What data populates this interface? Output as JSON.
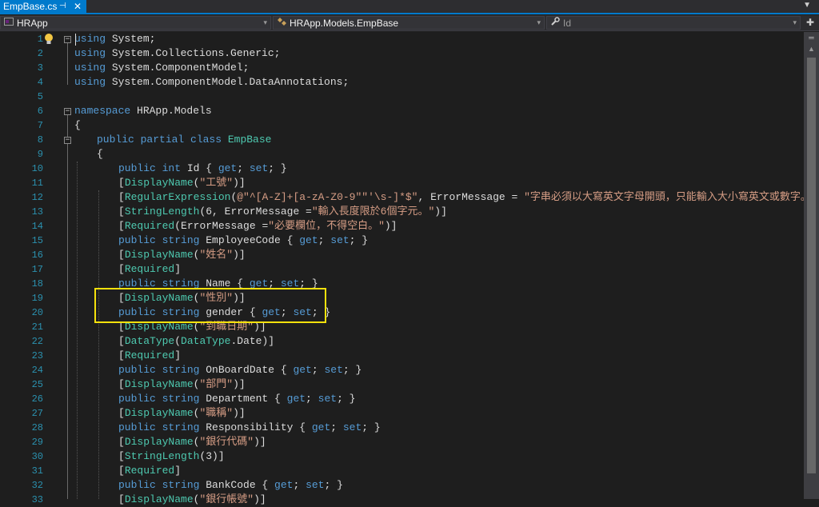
{
  "tab": {
    "title": "EmpBase.cs",
    "pin": "⊣",
    "close": "✕",
    "overflow": "▼"
  },
  "nav": {
    "project": "HRApp",
    "type": "HRApp.Models.EmpBase",
    "member": "Id",
    "arrow": "▾",
    "split_glyph": "✚"
  },
  "lines": [
    {
      "n": "1",
      "indent": 0,
      "parts": [
        {
          "c": "kw",
          "t": "using"
        },
        {
          "c": "",
          "t": " System;"
        }
      ]
    },
    {
      "n": "2",
      "indent": 0,
      "parts": [
        {
          "c": "kw",
          "t": "using"
        },
        {
          "c": "",
          "t": " System.Collections.Generic;"
        }
      ]
    },
    {
      "n": "3",
      "indent": 0,
      "parts": [
        {
          "c": "kw",
          "t": "using"
        },
        {
          "c": "",
          "t": " System.ComponentModel;"
        }
      ]
    },
    {
      "n": "4",
      "indent": 0,
      "parts": [
        {
          "c": "kw",
          "t": "using"
        },
        {
          "c": "",
          "t": " System.ComponentModel.DataAnnotations;"
        }
      ]
    },
    {
      "n": "5",
      "indent": 0,
      "parts": []
    },
    {
      "n": "6",
      "indent": 0,
      "parts": [
        {
          "c": "kw",
          "t": "namespace"
        },
        {
          "c": "",
          "t": " HRApp.Models"
        }
      ]
    },
    {
      "n": "7",
      "indent": 0,
      "parts": [
        {
          "c": "",
          "t": "{"
        }
      ]
    },
    {
      "n": "8",
      "indent": 1,
      "parts": [
        {
          "c": "kw",
          "t": "public partial class"
        },
        {
          "c": "",
          "t": " "
        },
        {
          "c": "tp",
          "t": "EmpBase"
        }
      ]
    },
    {
      "n": "9",
      "indent": 1,
      "parts": [
        {
          "c": "",
          "t": "{"
        }
      ]
    },
    {
      "n": "10",
      "indent": 2,
      "parts": [
        {
          "c": "kw",
          "t": "public int"
        },
        {
          "c": "",
          "t": " Id { "
        },
        {
          "c": "kw",
          "t": "get"
        },
        {
          "c": "",
          "t": "; "
        },
        {
          "c": "kw",
          "t": "set"
        },
        {
          "c": "",
          "t": "; }"
        }
      ]
    },
    {
      "n": "11",
      "indent": 2,
      "parts": [
        {
          "c": "",
          "t": "["
        },
        {
          "c": "tp",
          "t": "DisplayName"
        },
        {
          "c": "",
          "t": "("
        },
        {
          "c": "st",
          "t": "\"工號\""
        },
        {
          "c": "",
          "t": ")]"
        }
      ]
    },
    {
      "n": "12",
      "indent": 2,
      "parts": [
        {
          "c": "",
          "t": "["
        },
        {
          "c": "tp",
          "t": "RegularExpression"
        },
        {
          "c": "",
          "t": "("
        },
        {
          "c": "st",
          "t": "@\"^[A-Z]+[a-zA-Z0-9\"\"'\\s-]*$\""
        },
        {
          "c": "",
          "t": ", ErrorMessage = "
        },
        {
          "c": "st",
          "t": "\"字串必須以大寫英文字母開頭，只能輸入大小寫英文或數字。\""
        },
        {
          "c": "",
          "t": ")]"
        }
      ]
    },
    {
      "n": "13",
      "indent": 2,
      "parts": [
        {
          "c": "",
          "t": "["
        },
        {
          "c": "tp",
          "t": "StringLength"
        },
        {
          "c": "",
          "t": "(6, ErrorMessage ="
        },
        {
          "c": "st",
          "t": "\"輸入長度限於6個字元。\""
        },
        {
          "c": "",
          "t": ")]"
        }
      ]
    },
    {
      "n": "14",
      "indent": 2,
      "parts": [
        {
          "c": "",
          "t": "["
        },
        {
          "c": "tp",
          "t": "Required"
        },
        {
          "c": "",
          "t": "(ErrorMessage ="
        },
        {
          "c": "st",
          "t": "\"必要欄位，不得空白。\""
        },
        {
          "c": "",
          "t": ")]"
        }
      ]
    },
    {
      "n": "15",
      "indent": 2,
      "parts": [
        {
          "c": "kw",
          "t": "public string"
        },
        {
          "c": "",
          "t": " EmployeeCode { "
        },
        {
          "c": "kw",
          "t": "get"
        },
        {
          "c": "",
          "t": "; "
        },
        {
          "c": "kw",
          "t": "set"
        },
        {
          "c": "",
          "t": "; }"
        }
      ]
    },
    {
      "n": "16",
      "indent": 2,
      "parts": [
        {
          "c": "",
          "t": "["
        },
        {
          "c": "tp",
          "t": "DisplayName"
        },
        {
          "c": "",
          "t": "("
        },
        {
          "c": "st",
          "t": "\"姓名\""
        },
        {
          "c": "",
          "t": ")]"
        }
      ]
    },
    {
      "n": "17",
      "indent": 2,
      "parts": [
        {
          "c": "",
          "t": "["
        },
        {
          "c": "tp",
          "t": "Required"
        },
        {
          "c": "",
          "t": "]"
        }
      ]
    },
    {
      "n": "18",
      "indent": 2,
      "parts": [
        {
          "c": "kw",
          "t": "public string"
        },
        {
          "c": "",
          "t": " Name { "
        },
        {
          "c": "kw",
          "t": "get"
        },
        {
          "c": "",
          "t": "; "
        },
        {
          "c": "kw",
          "t": "set"
        },
        {
          "c": "",
          "t": "; }"
        }
      ]
    },
    {
      "n": "19",
      "indent": 2,
      "parts": [
        {
          "c": "",
          "t": "["
        },
        {
          "c": "tp",
          "t": "DisplayName"
        },
        {
          "c": "",
          "t": "("
        },
        {
          "c": "st",
          "t": "\"性別\""
        },
        {
          "c": "",
          "t": ")]"
        }
      ]
    },
    {
      "n": "20",
      "indent": 2,
      "parts": [
        {
          "c": "kw",
          "t": "public string"
        },
        {
          "c": "",
          "t": " gender { "
        },
        {
          "c": "kw",
          "t": "get"
        },
        {
          "c": "",
          "t": "; "
        },
        {
          "c": "kw",
          "t": "set"
        },
        {
          "c": "",
          "t": "; }"
        }
      ]
    },
    {
      "n": "21",
      "indent": 2,
      "parts": [
        {
          "c": "",
          "t": "["
        },
        {
          "c": "tp",
          "t": "DisplayName"
        },
        {
          "c": "",
          "t": "("
        },
        {
          "c": "st",
          "t": "\"到職日期\""
        },
        {
          "c": "",
          "t": ")]"
        }
      ]
    },
    {
      "n": "22",
      "indent": 2,
      "parts": [
        {
          "c": "",
          "t": "["
        },
        {
          "c": "tp",
          "t": "DataType"
        },
        {
          "c": "",
          "t": "("
        },
        {
          "c": "tp",
          "t": "DataType"
        },
        {
          "c": "",
          "t": ".Date)]"
        }
      ]
    },
    {
      "n": "23",
      "indent": 2,
      "parts": [
        {
          "c": "",
          "t": "["
        },
        {
          "c": "tp",
          "t": "Required"
        },
        {
          "c": "",
          "t": "]"
        }
      ]
    },
    {
      "n": "24",
      "indent": 2,
      "parts": [
        {
          "c": "kw",
          "t": "public string"
        },
        {
          "c": "",
          "t": " OnBoardDate { "
        },
        {
          "c": "kw",
          "t": "get"
        },
        {
          "c": "",
          "t": "; "
        },
        {
          "c": "kw",
          "t": "set"
        },
        {
          "c": "",
          "t": "; }"
        }
      ]
    },
    {
      "n": "25",
      "indent": 2,
      "parts": [
        {
          "c": "",
          "t": "["
        },
        {
          "c": "tp",
          "t": "DisplayName"
        },
        {
          "c": "",
          "t": "("
        },
        {
          "c": "st",
          "t": "\"部門\""
        },
        {
          "c": "",
          "t": ")]"
        }
      ]
    },
    {
      "n": "26",
      "indent": 2,
      "parts": [
        {
          "c": "kw",
          "t": "public string"
        },
        {
          "c": "",
          "t": " Department { "
        },
        {
          "c": "kw",
          "t": "get"
        },
        {
          "c": "",
          "t": "; "
        },
        {
          "c": "kw",
          "t": "set"
        },
        {
          "c": "",
          "t": "; }"
        }
      ]
    },
    {
      "n": "27",
      "indent": 2,
      "parts": [
        {
          "c": "",
          "t": "["
        },
        {
          "c": "tp",
          "t": "DisplayName"
        },
        {
          "c": "",
          "t": "("
        },
        {
          "c": "st",
          "t": "\"職稱\""
        },
        {
          "c": "",
          "t": ")]"
        }
      ]
    },
    {
      "n": "28",
      "indent": 2,
      "parts": [
        {
          "c": "kw",
          "t": "public string"
        },
        {
          "c": "",
          "t": " Responsibility { "
        },
        {
          "c": "kw",
          "t": "get"
        },
        {
          "c": "",
          "t": "; "
        },
        {
          "c": "kw",
          "t": "set"
        },
        {
          "c": "",
          "t": "; }"
        }
      ]
    },
    {
      "n": "29",
      "indent": 2,
      "parts": [
        {
          "c": "",
          "t": "["
        },
        {
          "c": "tp",
          "t": "DisplayName"
        },
        {
          "c": "",
          "t": "("
        },
        {
          "c": "st",
          "t": "\"銀行代碼\""
        },
        {
          "c": "",
          "t": ")]"
        }
      ]
    },
    {
      "n": "30",
      "indent": 2,
      "parts": [
        {
          "c": "",
          "t": "["
        },
        {
          "c": "tp",
          "t": "StringLength"
        },
        {
          "c": "",
          "t": "(3)]"
        }
      ]
    },
    {
      "n": "31",
      "indent": 2,
      "parts": [
        {
          "c": "",
          "t": "["
        },
        {
          "c": "tp",
          "t": "Required"
        },
        {
          "c": "",
          "t": "]"
        }
      ]
    },
    {
      "n": "32",
      "indent": 2,
      "parts": [
        {
          "c": "kw",
          "t": "public string"
        },
        {
          "c": "",
          "t": " BankCode { "
        },
        {
          "c": "kw",
          "t": "get"
        },
        {
          "c": "",
          "t": "; "
        },
        {
          "c": "kw",
          "t": "set"
        },
        {
          "c": "",
          "t": "; }"
        }
      ]
    },
    {
      "n": "33",
      "indent": 2,
      "parts": [
        {
          "c": "",
          "t": "["
        },
        {
          "c": "tp",
          "t": "DisplayName"
        },
        {
          "c": "",
          "t": "("
        },
        {
          "c": "st",
          "t": "\"銀行帳號\""
        },
        {
          "c": "",
          "t": ")]"
        }
      ]
    }
  ],
  "colors": {
    "accent": "#007acc",
    "keyword": "#569cd6",
    "type": "#4ec9b0",
    "string": "#d69d85",
    "linenumber": "#2b91af",
    "highlight": "#f5e10c"
  },
  "icons": {
    "lightbulb": "lightbulb-icon",
    "fold": "fold-minus-icon",
    "project": "csharp-project-icon",
    "class": "class-icon",
    "member": "wrench-icon"
  }
}
